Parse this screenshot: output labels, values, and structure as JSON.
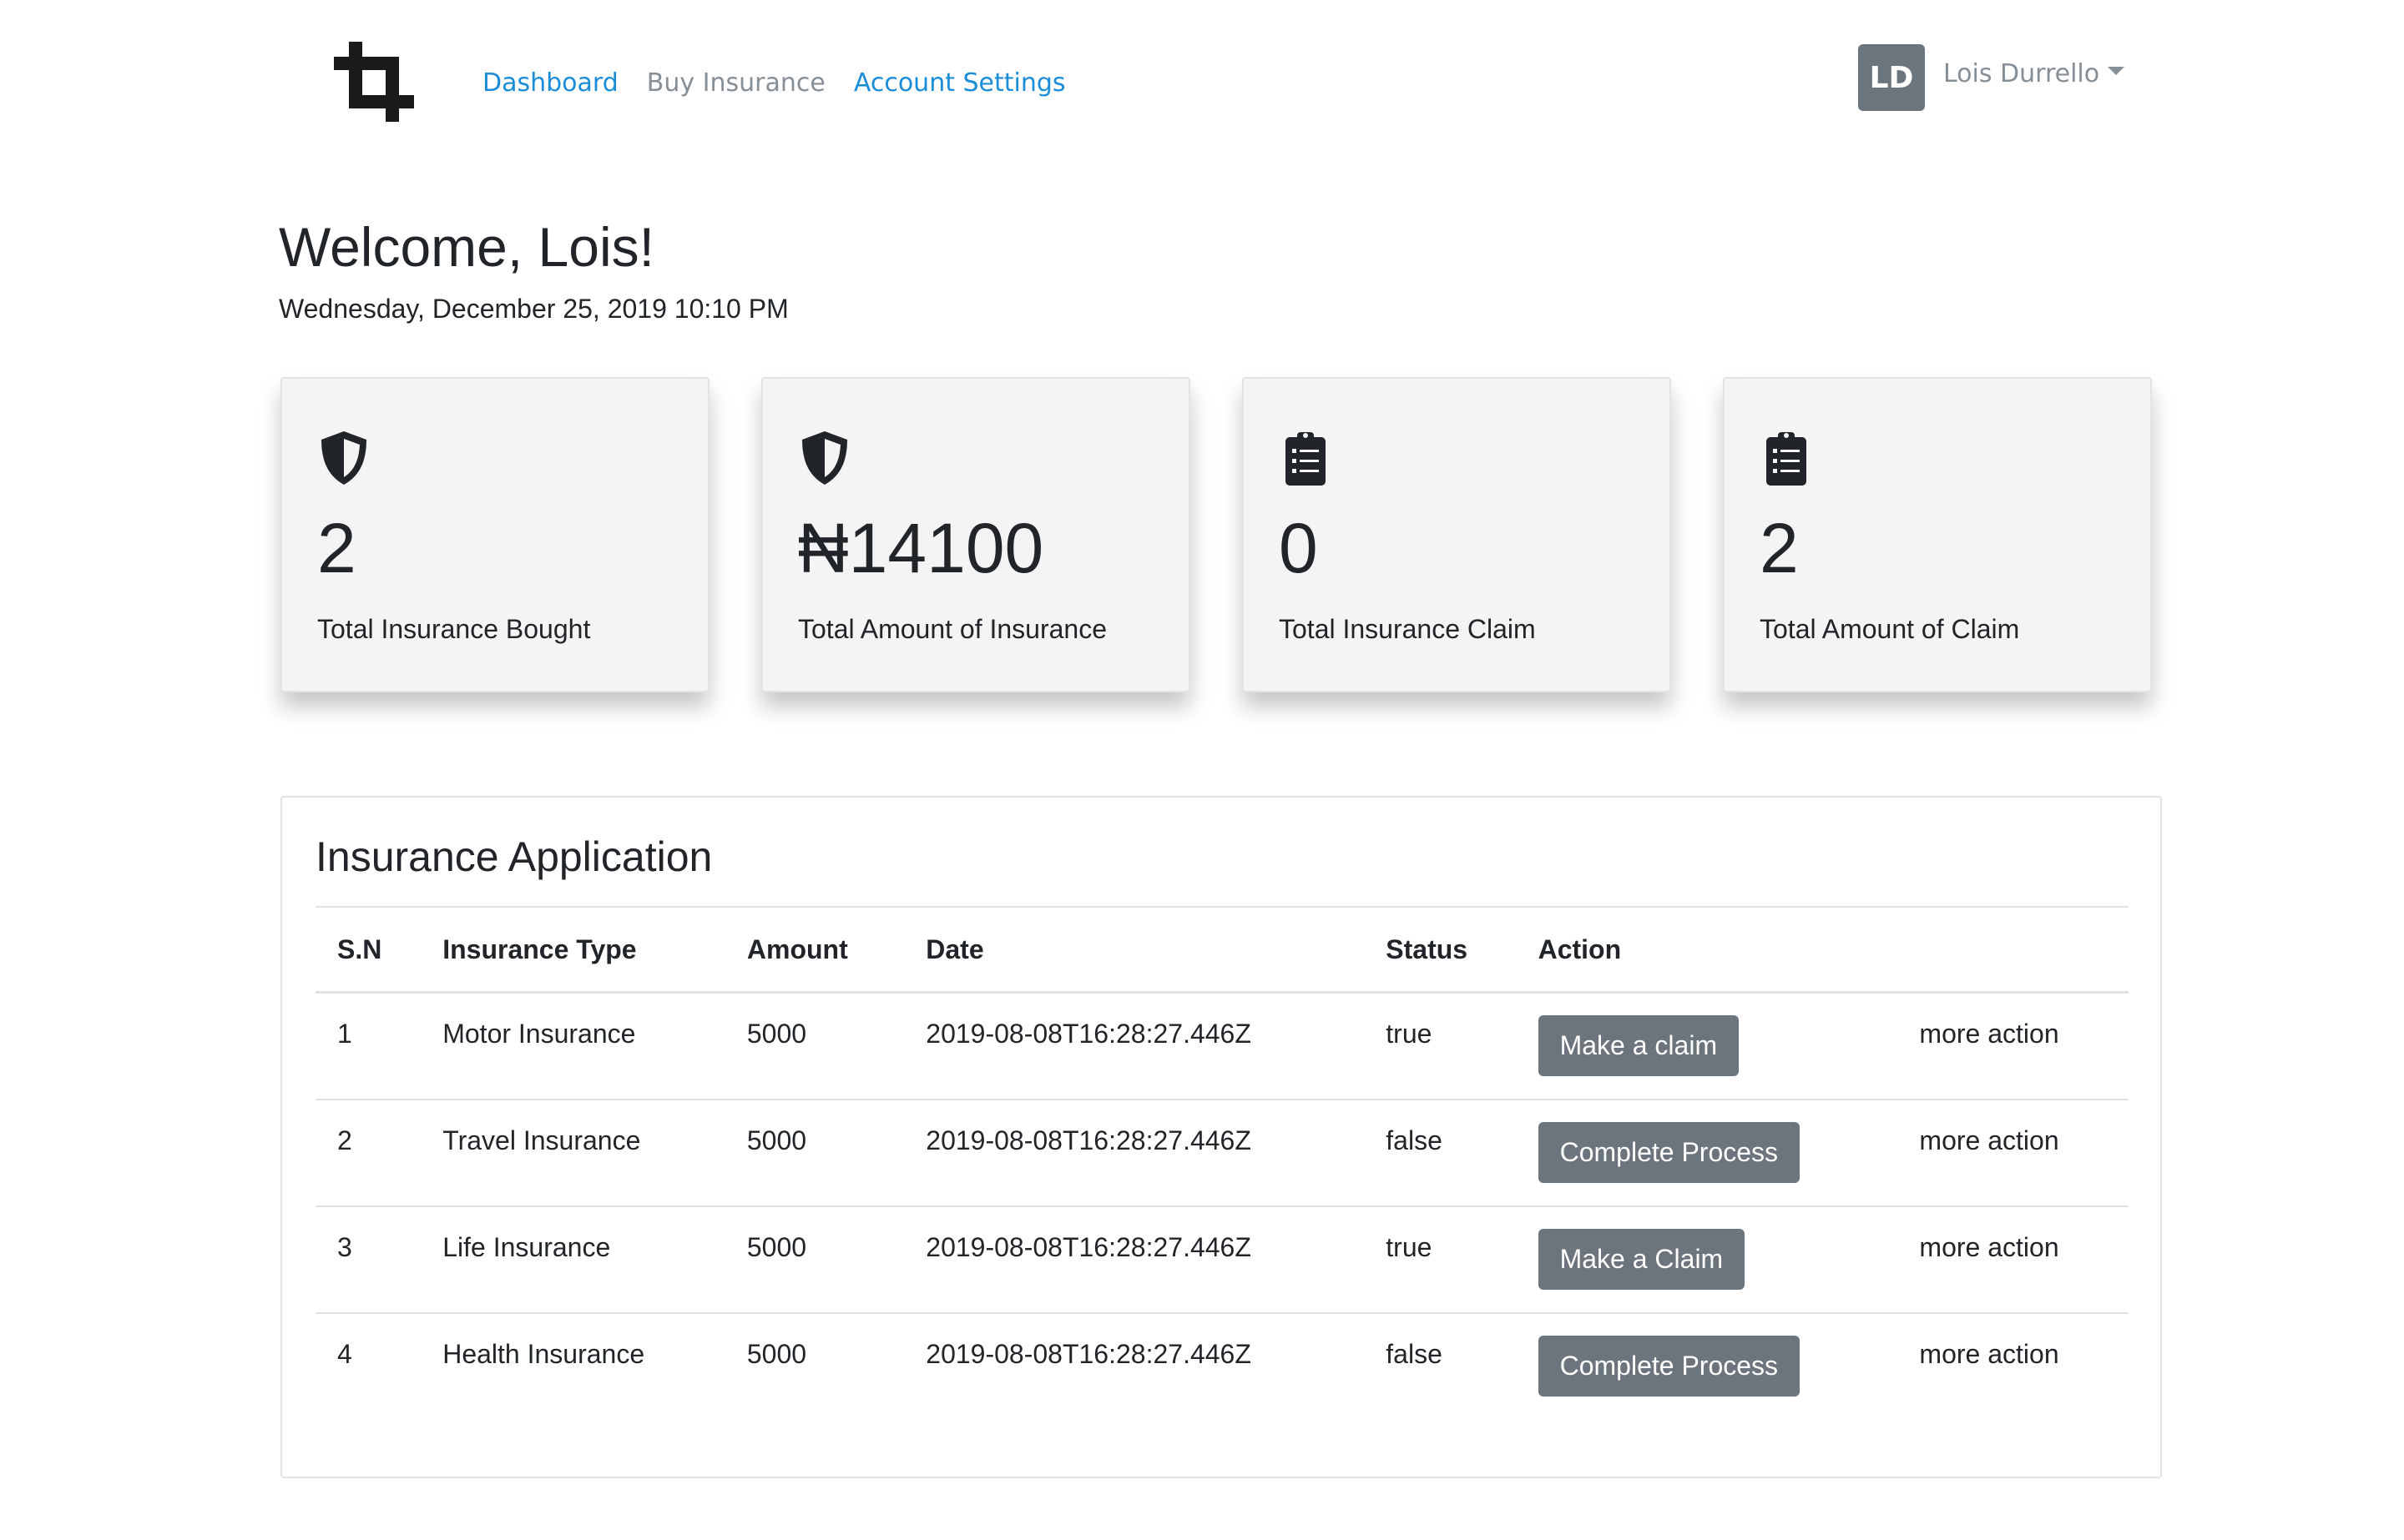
{
  "nav": {
    "links": [
      "Dashboard",
      "Buy Insurance",
      "Account Settings"
    ],
    "user_initials": "LD",
    "user_name": "Lois Durrello"
  },
  "welcome": {
    "title": "Welcome, Lois!",
    "date": "Wednesday, December 25, 2019 10:10 PM"
  },
  "cards": [
    {
      "icon": "shield-icon",
      "value": "2",
      "label": "Total Insurance Bought"
    },
    {
      "icon": "shield-icon",
      "value": "₦14100",
      "label": "Total Amount of Insurance"
    },
    {
      "icon": "clipboard-list-icon",
      "value": "0",
      "label": "Total Insurance Claim"
    },
    {
      "icon": "clipboard-list-icon",
      "value": "2",
      "label": "Total Amount of Claim"
    }
  ],
  "applications": {
    "title": "Insurance Application",
    "columns": [
      "S.N",
      "Insurance Type",
      "Amount",
      "Date",
      "Status",
      "Action"
    ],
    "rows": [
      {
        "sn": "1",
        "type": "Motor Insurance",
        "amount": "5000",
        "date": "2019-08-08T16:28:27.446Z",
        "status": "true",
        "action": "Make a claim",
        "more": "more action"
      },
      {
        "sn": "2",
        "type": "Travel Insurance",
        "amount": "5000",
        "date": "2019-08-08T16:28:27.446Z",
        "status": "false",
        "action": "Complete Process",
        "more": "more action"
      },
      {
        "sn": "3",
        "type": "Life Insurance",
        "amount": "5000",
        "date": "2019-08-08T16:28:27.446Z",
        "status": "true",
        "action": "Make a Claim",
        "more": "more action"
      },
      {
        "sn": "4",
        "type": "Health Insurance",
        "amount": "5000",
        "date": "2019-08-08T16:28:27.446Z",
        "status": "false",
        "action": "Complete Process",
        "more": "more action"
      }
    ]
  },
  "colors": {
    "link": "#1a8cd8",
    "muted": "#868e96",
    "button": "#6c757d",
    "card_bg": "#f4f4f4"
  }
}
